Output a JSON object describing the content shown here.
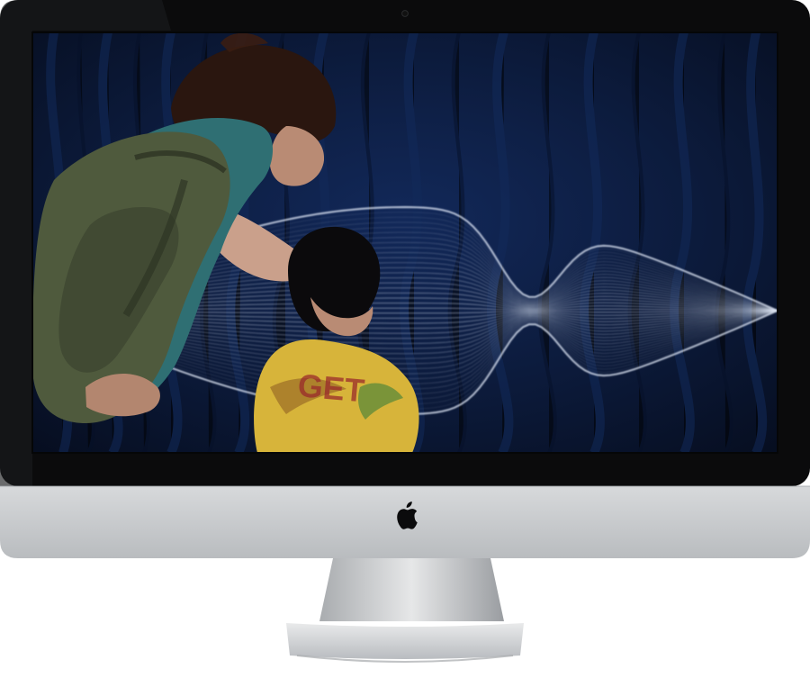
{
  "device": {
    "type": "imac",
    "logo_icon": "apple-logo-icon",
    "bezel_color": "#0b0b0c",
    "chin_color": "#c9cbcd",
    "stand_color": "#d2d4d6"
  },
  "screen": {
    "background_color": "#0c1a3a",
    "curtain_color": "#122a5a",
    "wave_color": "#e6eefc",
    "people": {
      "adult_shirt_color": "#2f6f73",
      "backpack_color": "#4f5a3d",
      "child_shirt_color": "#d7b43a"
    },
    "shirt_print_text": "GET"
  }
}
